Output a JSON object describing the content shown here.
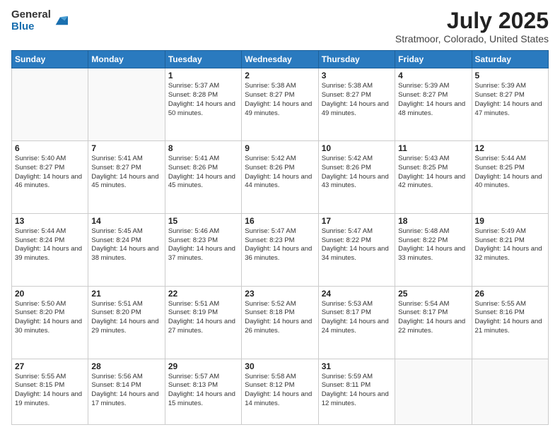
{
  "header": {
    "logo_general": "General",
    "logo_blue": "Blue",
    "month_title": "July 2025",
    "location": "Stratmoor, Colorado, United States"
  },
  "days_of_week": [
    "Sunday",
    "Monday",
    "Tuesday",
    "Wednesday",
    "Thursday",
    "Friday",
    "Saturday"
  ],
  "weeks": [
    [
      {
        "day": "",
        "sunrise": "",
        "sunset": "",
        "daylight": ""
      },
      {
        "day": "",
        "sunrise": "",
        "sunset": "",
        "daylight": ""
      },
      {
        "day": "1",
        "sunrise": "Sunrise: 5:37 AM",
        "sunset": "Sunset: 8:28 PM",
        "daylight": "Daylight: 14 hours and 50 minutes."
      },
      {
        "day": "2",
        "sunrise": "Sunrise: 5:38 AM",
        "sunset": "Sunset: 8:27 PM",
        "daylight": "Daylight: 14 hours and 49 minutes."
      },
      {
        "day": "3",
        "sunrise": "Sunrise: 5:38 AM",
        "sunset": "Sunset: 8:27 PM",
        "daylight": "Daylight: 14 hours and 49 minutes."
      },
      {
        "day": "4",
        "sunrise": "Sunrise: 5:39 AM",
        "sunset": "Sunset: 8:27 PM",
        "daylight": "Daylight: 14 hours and 48 minutes."
      },
      {
        "day": "5",
        "sunrise": "Sunrise: 5:39 AM",
        "sunset": "Sunset: 8:27 PM",
        "daylight": "Daylight: 14 hours and 47 minutes."
      }
    ],
    [
      {
        "day": "6",
        "sunrise": "Sunrise: 5:40 AM",
        "sunset": "Sunset: 8:27 PM",
        "daylight": "Daylight: 14 hours and 46 minutes."
      },
      {
        "day": "7",
        "sunrise": "Sunrise: 5:41 AM",
        "sunset": "Sunset: 8:27 PM",
        "daylight": "Daylight: 14 hours and 45 minutes."
      },
      {
        "day": "8",
        "sunrise": "Sunrise: 5:41 AM",
        "sunset": "Sunset: 8:26 PM",
        "daylight": "Daylight: 14 hours and 45 minutes."
      },
      {
        "day": "9",
        "sunrise": "Sunrise: 5:42 AM",
        "sunset": "Sunset: 8:26 PM",
        "daylight": "Daylight: 14 hours and 44 minutes."
      },
      {
        "day": "10",
        "sunrise": "Sunrise: 5:42 AM",
        "sunset": "Sunset: 8:26 PM",
        "daylight": "Daylight: 14 hours and 43 minutes."
      },
      {
        "day": "11",
        "sunrise": "Sunrise: 5:43 AM",
        "sunset": "Sunset: 8:25 PM",
        "daylight": "Daylight: 14 hours and 42 minutes."
      },
      {
        "day": "12",
        "sunrise": "Sunrise: 5:44 AM",
        "sunset": "Sunset: 8:25 PM",
        "daylight": "Daylight: 14 hours and 40 minutes."
      }
    ],
    [
      {
        "day": "13",
        "sunrise": "Sunrise: 5:44 AM",
        "sunset": "Sunset: 8:24 PM",
        "daylight": "Daylight: 14 hours and 39 minutes."
      },
      {
        "day": "14",
        "sunrise": "Sunrise: 5:45 AM",
        "sunset": "Sunset: 8:24 PM",
        "daylight": "Daylight: 14 hours and 38 minutes."
      },
      {
        "day": "15",
        "sunrise": "Sunrise: 5:46 AM",
        "sunset": "Sunset: 8:23 PM",
        "daylight": "Daylight: 14 hours and 37 minutes."
      },
      {
        "day": "16",
        "sunrise": "Sunrise: 5:47 AM",
        "sunset": "Sunset: 8:23 PM",
        "daylight": "Daylight: 14 hours and 36 minutes."
      },
      {
        "day": "17",
        "sunrise": "Sunrise: 5:47 AM",
        "sunset": "Sunset: 8:22 PM",
        "daylight": "Daylight: 14 hours and 34 minutes."
      },
      {
        "day": "18",
        "sunrise": "Sunrise: 5:48 AM",
        "sunset": "Sunset: 8:22 PM",
        "daylight": "Daylight: 14 hours and 33 minutes."
      },
      {
        "day": "19",
        "sunrise": "Sunrise: 5:49 AM",
        "sunset": "Sunset: 8:21 PM",
        "daylight": "Daylight: 14 hours and 32 minutes."
      }
    ],
    [
      {
        "day": "20",
        "sunrise": "Sunrise: 5:50 AM",
        "sunset": "Sunset: 8:20 PM",
        "daylight": "Daylight: 14 hours and 30 minutes."
      },
      {
        "day": "21",
        "sunrise": "Sunrise: 5:51 AM",
        "sunset": "Sunset: 8:20 PM",
        "daylight": "Daylight: 14 hours and 29 minutes."
      },
      {
        "day": "22",
        "sunrise": "Sunrise: 5:51 AM",
        "sunset": "Sunset: 8:19 PM",
        "daylight": "Daylight: 14 hours and 27 minutes."
      },
      {
        "day": "23",
        "sunrise": "Sunrise: 5:52 AM",
        "sunset": "Sunset: 8:18 PM",
        "daylight": "Daylight: 14 hours and 26 minutes."
      },
      {
        "day": "24",
        "sunrise": "Sunrise: 5:53 AM",
        "sunset": "Sunset: 8:17 PM",
        "daylight": "Daylight: 14 hours and 24 minutes."
      },
      {
        "day": "25",
        "sunrise": "Sunrise: 5:54 AM",
        "sunset": "Sunset: 8:17 PM",
        "daylight": "Daylight: 14 hours and 22 minutes."
      },
      {
        "day": "26",
        "sunrise": "Sunrise: 5:55 AM",
        "sunset": "Sunset: 8:16 PM",
        "daylight": "Daylight: 14 hours and 21 minutes."
      }
    ],
    [
      {
        "day": "27",
        "sunrise": "Sunrise: 5:55 AM",
        "sunset": "Sunset: 8:15 PM",
        "daylight": "Daylight: 14 hours and 19 minutes."
      },
      {
        "day": "28",
        "sunrise": "Sunrise: 5:56 AM",
        "sunset": "Sunset: 8:14 PM",
        "daylight": "Daylight: 14 hours and 17 minutes."
      },
      {
        "day": "29",
        "sunrise": "Sunrise: 5:57 AM",
        "sunset": "Sunset: 8:13 PM",
        "daylight": "Daylight: 14 hours and 15 minutes."
      },
      {
        "day": "30",
        "sunrise": "Sunrise: 5:58 AM",
        "sunset": "Sunset: 8:12 PM",
        "daylight": "Daylight: 14 hours and 14 minutes."
      },
      {
        "day": "31",
        "sunrise": "Sunrise: 5:59 AM",
        "sunset": "Sunset: 8:11 PM",
        "daylight": "Daylight: 14 hours and 12 minutes."
      },
      {
        "day": "",
        "sunrise": "",
        "sunset": "",
        "daylight": ""
      },
      {
        "day": "",
        "sunrise": "",
        "sunset": "",
        "daylight": ""
      }
    ]
  ]
}
